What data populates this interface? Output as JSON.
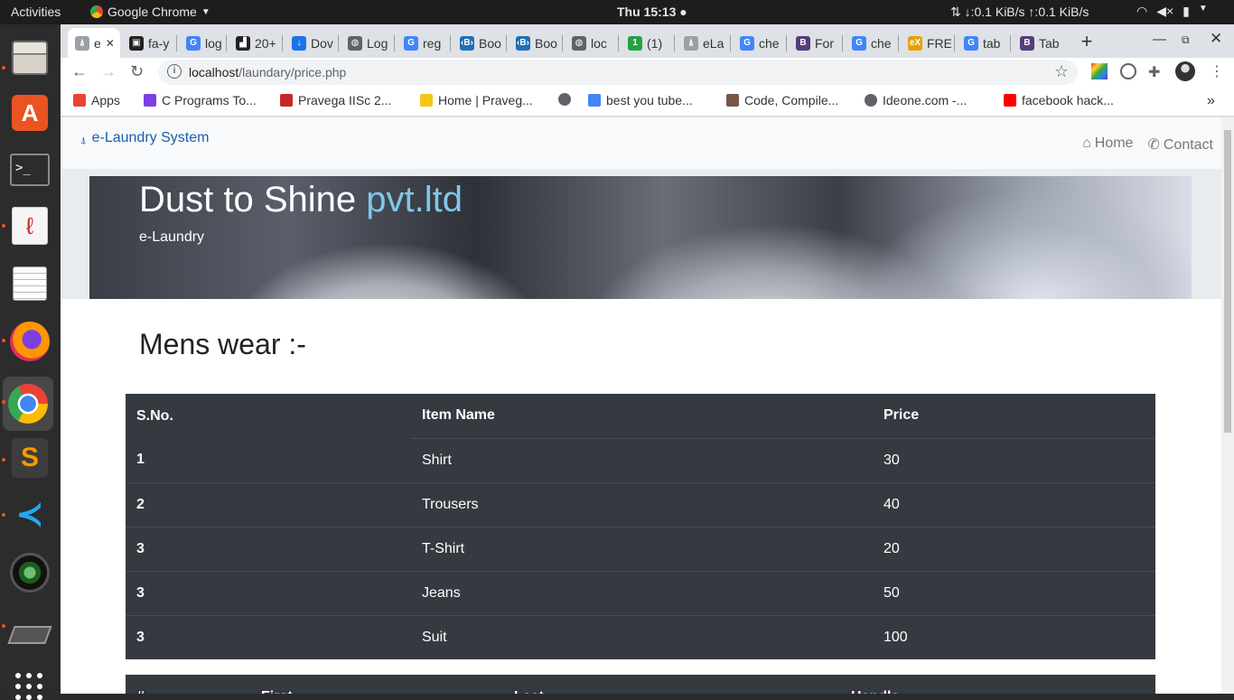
{
  "system_bar": {
    "activities": "Activities",
    "app_name": "Google Chrome",
    "clock": "Thu 15:13 ●",
    "netspeed": "⇅ ↓:0.1 KiB/s ↑:0.1 KiB/s"
  },
  "browser": {
    "tabs": [
      {
        "label": "e",
        "fav_color": "#9aa0a6",
        "fav_text": "⍋",
        "active": true
      },
      {
        "label": "fa-y",
        "fav_color": "#222",
        "fav_text": "▣"
      },
      {
        "label": "log",
        "fav_color": "#4285f4",
        "fav_text": "G"
      },
      {
        "label": "20+",
        "fav_color": "#222",
        "fav_text": "▟"
      },
      {
        "label": "Dov",
        "fav_color": "#1a73e8",
        "fav_text": "↓"
      },
      {
        "label": "Log",
        "fav_color": "#5f6368",
        "fav_text": "◍"
      },
      {
        "label": "reg",
        "fav_color": "#4285f4",
        "fav_text": "G"
      },
      {
        "label": "Boo",
        "fav_color": "#1f6fb5",
        "fav_text": "‹B›"
      },
      {
        "label": "Boo",
        "fav_color": "#1f6fb5",
        "fav_text": "‹B›"
      },
      {
        "label": "loc",
        "fav_color": "#5f6368",
        "fav_text": "◍"
      },
      {
        "label": "(1)",
        "fav_color": "#25a244",
        "fav_text": "1"
      },
      {
        "label": "eLa",
        "fav_color": "#9aa0a6",
        "fav_text": "⍋"
      },
      {
        "label": "che",
        "fav_color": "#4285f4",
        "fav_text": "G"
      },
      {
        "label": "For",
        "fav_color": "#563d7c",
        "fav_text": "B"
      },
      {
        "label": "che",
        "fav_color": "#4285f4",
        "fav_text": "G"
      },
      {
        "label": "FRE",
        "fav_color": "#e8a000",
        "fav_text": "eX"
      },
      {
        "label": "tab",
        "fav_color": "#4285f4",
        "fav_text": "G"
      },
      {
        "label": "Tab",
        "fav_color": "#563d7c",
        "fav_text": "B"
      }
    ],
    "new_tab": "+",
    "url_host": "localhost",
    "url_path": "/laundary/price.php",
    "bookmarks": [
      {
        "label": "Apps",
        "color": "#ea4335"
      },
      {
        "label": "C Programs To...",
        "color": "#7b3fe4"
      },
      {
        "label": "Pravega IISc 2...",
        "color": "#c62828"
      },
      {
        "label": "Home | Praveg...",
        "color": "#f5c518"
      },
      {
        "label": "",
        "color": "#5f6368"
      },
      {
        "label": "best you tube...",
        "color": "#4285f4"
      },
      {
        "label": "Code, Compile...",
        "color": "#795548"
      },
      {
        "label": "Ideone.com -...",
        "color": "#5f6368"
      },
      {
        "label": "facebook hack...",
        "color": "#ff0000"
      }
    ],
    "more_bookmarks": "»"
  },
  "site": {
    "brand": "e-Laundry System",
    "nav": [
      {
        "icon": "home-icon",
        "glyph": "⌂",
        "label": "Home"
      },
      {
        "icon": "phone-icon",
        "glyph": "✆",
        "label": "Contact"
      }
    ],
    "hero_title_main": "Dust to Shine ",
    "hero_title_accent": "pvt.ltd",
    "hero_subtitle": "e-Laundry",
    "section_title": "Mens wear :-",
    "price_table": {
      "headers": [
        "S.No.",
        "Item Name",
        "Price"
      ],
      "rows": [
        [
          "1",
          "Shirt",
          "30"
        ],
        [
          "2",
          "Trousers",
          "40"
        ],
        [
          "3",
          "T-Shirt",
          "20"
        ],
        [
          "3",
          "Jeans",
          "50"
        ],
        [
          "3",
          "Suit",
          "100"
        ]
      ]
    },
    "second_table": {
      "headers": [
        "#",
        "First",
        "Last",
        "Handle"
      ]
    }
  }
}
